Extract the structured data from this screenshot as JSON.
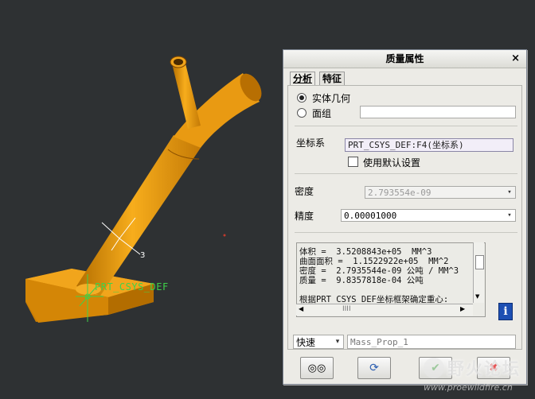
{
  "viewport": {
    "csys_label": "PRT_CSYS_DEF",
    "axis_label_3": "3"
  },
  "dialog": {
    "title": "质量属性",
    "close_label": "×",
    "tabs": [
      {
        "label": "分析",
        "active": true
      },
      {
        "label": "特征",
        "active": false
      }
    ],
    "geometry": {
      "solid_label": "实体几何",
      "solid_selected": true,
      "quilt_label": "面组",
      "quilt_value": ""
    },
    "coord_sys": {
      "label": "坐标系",
      "value": "PRT_CSYS_DEF:F4(坐标系)",
      "use_default_label": "使用默认设置",
      "use_default_checked": false
    },
    "density": {
      "label": "密度",
      "value": "2.793554e-09"
    },
    "accuracy": {
      "label": "精度",
      "value": "0.00001000"
    },
    "results": [
      "体积 =  3.5208843e+05  MM^3",
      "曲面面积 =  1.1522922e+05  MM^2",
      "密度 =  2.7935544e-09 公吨 / MM^3",
      "质量 =  9.8357818e-04 公吨",
      "",
      "根据PRT_CSYS_DEF坐标框架确定重心:"
    ],
    "hscroll_thumb": "IIII",
    "mode": {
      "value": "快速"
    },
    "name_field": {
      "value": "Mass_Prop_1"
    },
    "buttons": {
      "preview_icon": "glasses-icon",
      "repeat_icon": "repeat-icon",
      "ok_icon": "check-icon",
      "cancel_icon": "x-icon"
    }
  },
  "watermark": {
    "text": "野火论坛",
    "url": "www.proewildfire.cn"
  },
  "colors": {
    "background": "#2e3133",
    "part_orange": "#e99a12",
    "csys_green": "#3fd24a",
    "dialog_bg": "#ecebe6"
  }
}
